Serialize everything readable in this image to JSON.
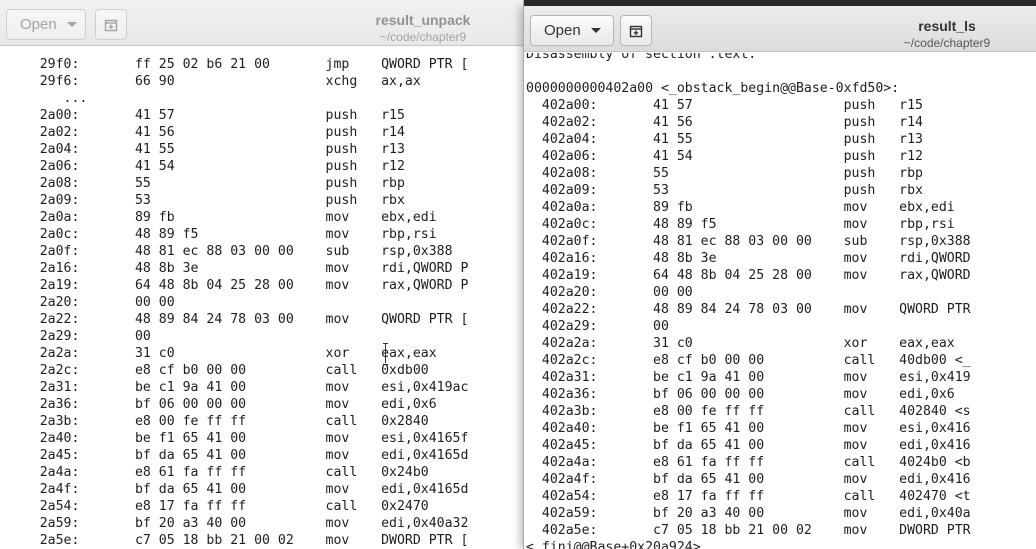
{
  "left_window": {
    "open_label": "Open",
    "title": "result_unpack",
    "subtitle": "~/code/chapter9",
    "lines": [
      "     29f0:       ff 25 02 b6 21 00       jmp    QWORD PTR [",
      "     29f6:       66 90                   xchg   ax,ax",
      "        ...",
      "     2a00:       41 57                   push   r15",
      "     2a02:       41 56                   push   r14",
      "     2a04:       41 55                   push   r13",
      "     2a06:       41 54                   push   r12",
      "     2a08:       55                      push   rbp",
      "     2a09:       53                      push   rbx",
      "     2a0a:       89 fb                   mov    ebx,edi",
      "     2a0c:       48 89 f5                mov    rbp,rsi",
      "     2a0f:       48 81 ec 88 03 00 00    sub    rsp,0x388",
      "     2a16:       48 8b 3e                mov    rdi,QWORD P",
      "     2a19:       64 48 8b 04 25 28 00    mov    rax,QWORD P",
      "     2a20:       00 00",
      "     2a22:       48 89 84 24 78 03 00    mov    QWORD PTR [",
      "     2a29:       00",
      "     2a2a:       31 c0                   xor    eax,eax",
      "     2a2c:       e8 cf b0 00 00          call   0xdb00",
      "     2a31:       be c1 9a 41 00          mov    esi,0x419ac",
      "     2a36:       bf 06 00 00 00          mov    edi,0x6",
      "     2a3b:       e8 00 fe ff ff          call   0x2840",
      "     2a40:       be f1 65 41 00          mov    esi,0x4165f",
      "     2a45:       bf da 65 41 00          mov    edi,0x4165d",
      "     2a4a:       e8 61 fa ff ff          call   0x24b0",
      "     2a4f:       bf da 65 41 00          mov    edi,0x4165d",
      "     2a54:       e8 17 fa ff ff          call   0x2470",
      "     2a59:       bf 20 a3 40 00          mov    edi,0x40a32",
      "     2a5e:       c7 05 18 bb 21 00 02    mov    DWORD PTR ["
    ]
  },
  "right_window": {
    "open_label": "Open",
    "title": "result_ls",
    "subtitle": "~/code/chapter9",
    "lines": [
      "Disassembly of section .text:",
      "",
      "0000000000402a00 <_obstack_begin@@Base-0xfd50>:",
      "  402a00:       41 57                   push   r15",
      "  402a02:       41 56                   push   r14",
      "  402a04:       41 55                   push   r13",
      "  402a06:       41 54                   push   r12",
      "  402a08:       55                      push   rbp",
      "  402a09:       53                      push   rbx",
      "  402a0a:       89 fb                   mov    ebx,edi",
      "  402a0c:       48 89 f5                mov    rbp,rsi",
      "  402a0f:       48 81 ec 88 03 00 00    sub    rsp,0x388",
      "  402a16:       48 8b 3e                mov    rdi,QWORD",
      "  402a19:       64 48 8b 04 25 28 00    mov    rax,QWORD",
      "  402a20:       00 00",
      "  402a22:       48 89 84 24 78 03 00    mov    QWORD PTR",
      "  402a29:       00",
      "  402a2a:       31 c0                   xor    eax,eax",
      "  402a2c:       e8 cf b0 00 00          call   40db00 <_",
      "  402a31:       be c1 9a 41 00          mov    esi,0x419",
      "  402a36:       bf 06 00 00 00          mov    edi,0x6",
      "  402a3b:       e8 00 fe ff ff          call   402840 <s",
      "  402a40:       be f1 65 41 00          mov    esi,0x416",
      "  402a45:       bf da 65 41 00          mov    edi,0x416",
      "  402a4a:       e8 61 fa ff ff          call   4024b0 <b",
      "  402a4f:       bf da 65 41 00          mov    edi,0x416",
      "  402a54:       e8 17 fa ff ff          call   402470 <t",
      "  402a59:       bf 20 a3 40 00          mov    edi,0x40a",
      "  402a5e:       c7 05 18 bb 21 00 02    mov    DWORD PTR",
      "<_fini@@Base+0x20a924>"
    ]
  }
}
